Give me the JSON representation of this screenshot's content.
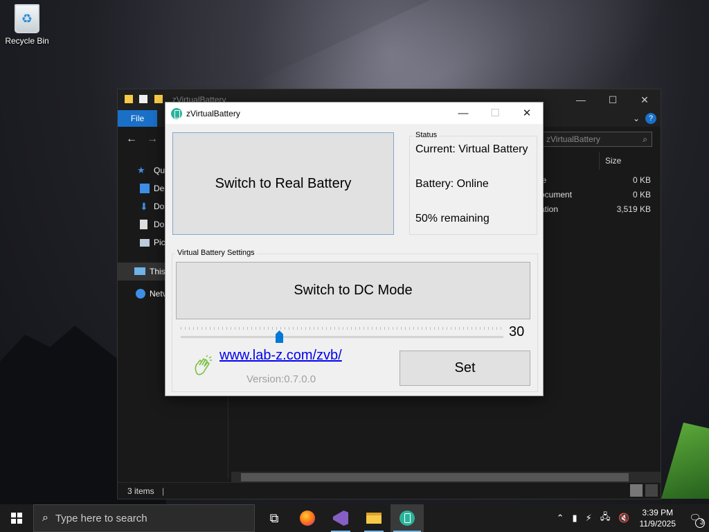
{
  "desktop": {
    "icons": [
      {
        "label": "Recycle Bin",
        "icon": "recycle-bin-icon"
      }
    ]
  },
  "explorer": {
    "title": "zVirtualBattery",
    "ribbon_file": "File",
    "help": "?",
    "search_placeholder": "zVirtualBattery",
    "sidebar": [
      {
        "label": "Quic",
        "icon": "star-icon",
        "color": "#3d8ee6"
      },
      {
        "label": "De",
        "icon": "desktop-icon",
        "color": "#3d8ee6"
      },
      {
        "label": "Do",
        "icon": "download-icon",
        "color": "#3d8ee6"
      },
      {
        "label": "Do",
        "icon": "document-icon",
        "color": "#dddddd"
      },
      {
        "label": "Pic",
        "icon": "pictures-icon",
        "color": "#bcd"
      },
      {
        "label": "This",
        "icon": "this-pc-icon",
        "color": "#6fb3e8"
      },
      {
        "label": "Netv",
        "icon": "network-icon",
        "color": "#3d8ee6"
      }
    ],
    "column_size": "Size",
    "rows": [
      {
        "name": "le",
        "size": "0 KB"
      },
      {
        "name": "ocument",
        "size": "0 KB"
      },
      {
        "name": "ation",
        "size": "3,519 KB"
      }
    ],
    "status": "3 items"
  },
  "app": {
    "title": "zVirtualBattery",
    "switch_real_label": "Switch to Real Battery",
    "status_legend": "Status",
    "status_current": "Current: Virtual Battery",
    "status_battery": "Battery: Online",
    "status_remaining": "50% remaining",
    "settings_legend": "Virtual Battery Settings",
    "switch_dc_label": "Switch to DC Mode",
    "slider_value": "30",
    "slider_fraction": 0.3,
    "link": "www.lab-z.com/zvb/",
    "version": "Version:0.7.0.0",
    "set_label": "Set",
    "accent": "#0078d7",
    "icon_color": "#2bb39a"
  },
  "taskbar": {
    "search_placeholder": "Type here to search",
    "time": "3:39 PM",
    "date": "11/9/2025",
    "notifications": "3"
  }
}
